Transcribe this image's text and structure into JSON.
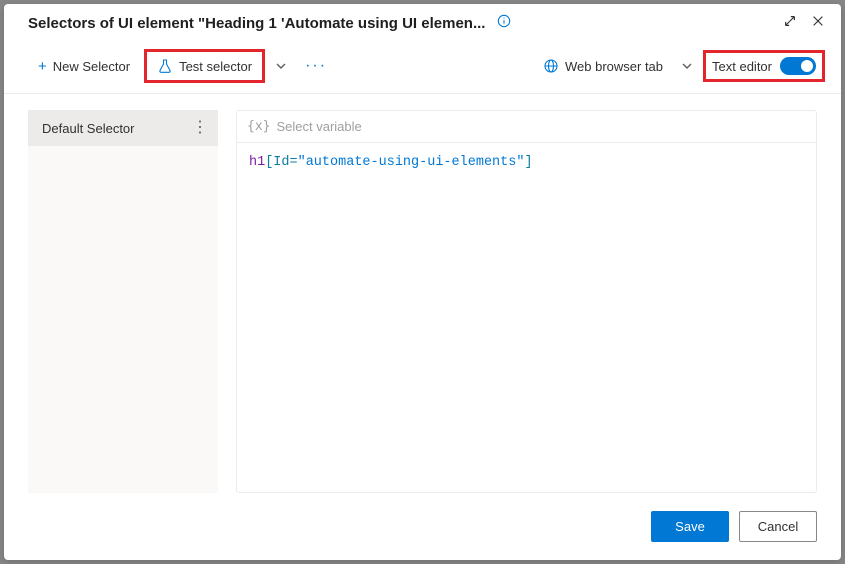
{
  "title": "Selectors of UI element \"Heading 1 'Automate using UI elemen...",
  "toolbar": {
    "new_selector_label": "New Selector",
    "test_selector_label": "Test selector",
    "web_browser_tab_label": "Web browser tab",
    "text_editor_label": "Text editor",
    "text_editor_on": true
  },
  "sidebar": {
    "items": [
      {
        "label": "Default Selector"
      }
    ]
  },
  "editor": {
    "variable_placeholder": "Select variable",
    "selector_tokens": {
      "tag": "h1",
      "attr_open": "[Id=",
      "value": "\"automate-using-ui-elements\"",
      "attr_close": "]"
    }
  },
  "footer": {
    "save_label": "Save",
    "cancel_label": "Cancel"
  }
}
